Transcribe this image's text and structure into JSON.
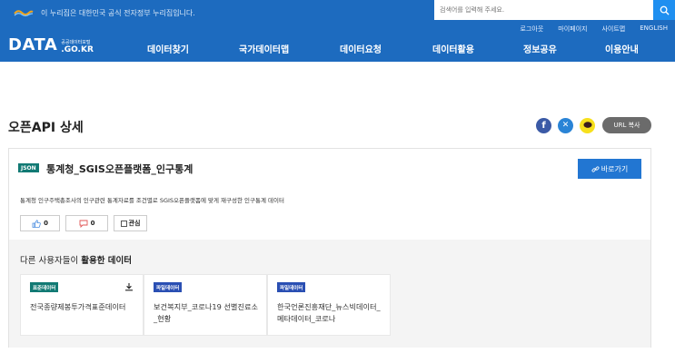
{
  "colors": {
    "header_bg": "#1d6bbf",
    "accent": "#2276d2",
    "json_badge": "#127a74",
    "standard_tag": "#127a74",
    "file_tag": "#2a4fb3"
  },
  "header": {
    "gov_notice": "이 누리집은 대한민국 공식 전자정부 누리집입니다.",
    "search_placeholder": "검색어를 입력해 주세요.",
    "util_links": [
      "로그아웃",
      "마이페이지",
      "사이트맵",
      "ENGLISH"
    ],
    "brand": {
      "main": "DATA",
      "sub_small": "공공데이터포털",
      "sub_domain": ".GO.KR"
    },
    "nav": [
      "데이터찾기",
      "국가데이터맵",
      "데이터요청",
      "데이터활용",
      "정보공유",
      "이용안내"
    ]
  },
  "page": {
    "title": "오픈API 상세",
    "share": {
      "icons": [
        "facebook-icon",
        "x-twitter-icon",
        "kakaotalk-icon"
      ],
      "url_copy_label": "URL 복사"
    }
  },
  "api": {
    "badge": "JSON",
    "title": "통계청_SGIS오픈플랫폼_인구통계",
    "go_button": "바로가기",
    "description": "통계청 인구주택총조사의 인구관련 통계자료를 조건별로 SGIS오픈플랫폼에 맞게 재구성한 인구통계 데이터",
    "likes": "0",
    "dislikes": "0",
    "interest_label": "관심"
  },
  "related": {
    "title_prefix": "다른 사용자들이 ",
    "title_bold": "활용한 데이터",
    "items": [
      {
        "tag": "표준데이터",
        "text": "전국종량제봉투가격표준데이터"
      },
      {
        "tag": "파일데이터",
        "text": "보건복지부_코로나19 선별진료소_현황"
      },
      {
        "tag": "파일데이터",
        "text": "한국언론진흥재단_뉴스빅데이터_메타데이터_코로나"
      }
    ]
  }
}
